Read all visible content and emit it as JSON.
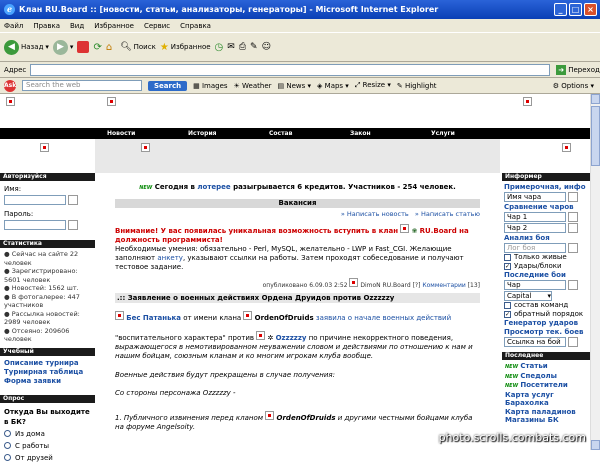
{
  "window": {
    "title": "Клан RU.Board :: [новости, статьи, анализаторы, генераторы] - Microsoft Internet Explorer"
  },
  "menu": [
    "Файл",
    "Правка",
    "Вид",
    "Избранное",
    "Сервис",
    "Справка"
  ],
  "toolbar": {
    "back": "Назад",
    "search": "Поиск",
    "favorites": "Избранное"
  },
  "address": {
    "label": "Адрес",
    "go": "Переход"
  },
  "searchbar": {
    "placeholder": "Search the web",
    "button": "Search",
    "items": [
      "Images",
      "Weather",
      "News",
      "Maps",
      "Resize",
      "Highlight"
    ],
    "options": "Options"
  },
  "nav": [
    "Новости",
    "История",
    "Состав",
    "Закон",
    "Услуги"
  ],
  "left": {
    "auth_header": "Авторизуйся",
    "name_label": "Имя:",
    "password_label": "Пароль:",
    "stats_header": "Статистика",
    "stats": [
      "Сейчас на сайте 22 человек",
      "Зарегистрировано: 5601 человек",
      "Новостей: 1562 шт.",
      "В фотогалерее: 447 участников",
      "Рассылка новостей: 2989 человек",
      "Отсеяно: 209606 человек"
    ],
    "tourn_header": "Учебный",
    "tourn_links": [
      "Описание турнира",
      "Турнирная таблица",
      "Форма заявки"
    ],
    "poll_header": "Опрос",
    "poll_question": "Откуда Вы выходите в БК?",
    "poll_options": [
      "Из дома",
      "С работы",
      "От друзей"
    ]
  },
  "main": {
    "lottery_new": "NEW",
    "lottery_a": "Сегодня в ",
    "lottery_link": "лотерее",
    "lottery_b": " разыгрывается 6 кредитов. Участников - 254 человек.",
    "vacancy_header": "Вакансия",
    "write_news": "Написать новость",
    "write_article": "Написать статью",
    "vacancy_red_a": "Внимание! У вас появилась уникальная возможность вступить в клан",
    "vacancy_red_b": "RU.Board на должность программиста!",
    "vacancy_text_a": "Необходимые умения: обязательно - Perl, MySQL, желательно - LWP и Fast_CGI. Желающие заполняют ",
    "vacancy_link": "анкету",
    "vacancy_text_b": ", указывают ссылки на работы. Затем проходят собеседование и получают тестовое задание.",
    "published": "опубликовано 6.09.03 2:52",
    "author": "DimoN RU.Board [?]",
    "comments": "Комментарии",
    "comments_count": "[13]",
    "statement_title": ".:: Заявление о военных действиях Ордена Друидов против Ozzzzzy",
    "s1_name": "Бес Патанька",
    "s1_mid": "от имени клана",
    "s1_clan": "OrdenOfDruids",
    "s1_text": "заявила о начале военных действий",
    "s2_a": "\"воспитательного характера\" против",
    "s2_name": "Ozzzzzy",
    "s2_b": "по причине некорректного поведения,",
    "s2_c": "выражающегося в немотивированном неуважении словом и действиями по отношению к нам и нашим бойцам, союзным кланам и ко многим игрокам клуба вообще.",
    "s3": "Военные действия будут прекращены в случае получения:",
    "s4": "Со стороны персонажа Ozzzzzy -",
    "s5_a": "1. Публичного извинения перед кланом",
    "s5_clan": "OrdenOfDruids",
    "s5_b": "и другими честными бойцами клуба на форуме Angelsoity."
  },
  "right": {
    "inform_header": "Информер",
    "items": [
      "Примерочная, инфо",
      "Сравнение чаров",
      "Анализ боя",
      "Последние бои",
      "Генератор ударов",
      "Просмотр тек. боев"
    ],
    "field_name": "Имя чара",
    "char1": "Чар 1",
    "char2": "Чар 2",
    "fight_log": "Лог боя",
    "only_live": "Только живые",
    "strikes": "Удары/блоки",
    "char": "Чар",
    "capital": "Capital",
    "team_comp": "состав команд",
    "reverse": "обратный порядок",
    "fight_link": "Ссылка на бой",
    "news_header": "Последнее",
    "news": [
      "Статьи",
      "Спедолы",
      "Посетители",
      "Карта услуг",
      "Барахолка",
      "Карта паладинов",
      "Магазины БК"
    ]
  },
  "watermark": "photo.scrolls.combats.com"
}
